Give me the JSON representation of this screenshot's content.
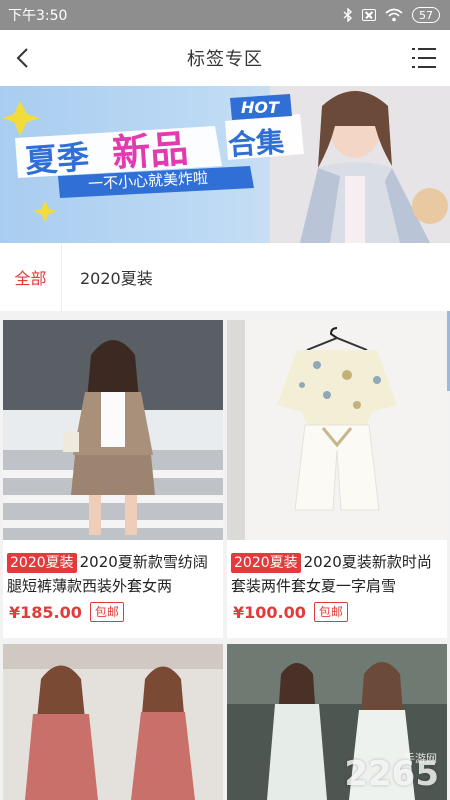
{
  "status_bar": {
    "time": "下午3:50",
    "battery": "57",
    "icons": [
      "bluetooth-icon",
      "no-sim-icon",
      "wifi-icon",
      "battery-icon"
    ]
  },
  "header": {
    "title": "标签专区",
    "back_icon": "chevron-left-icon",
    "menu_icon": "list-menu-icon"
  },
  "banner": {
    "hot": "HOT",
    "headline_1": "夏季",
    "headline_2": "新品",
    "headline_3": "合集",
    "slogan": "一不小心就美炸啦"
  },
  "filter": {
    "all_label": "全部",
    "tag_label": "2020夏装"
  },
  "products": [
    {
      "tag": "2020夏装",
      "title": "2020夏新款雪纺阔腿短裤薄款西装外套女两",
      "price": "¥185.00",
      "shipping": "包邮"
    },
    {
      "tag": "2020夏装",
      "title": "2020夏装新款时尚套装两件套女夏一字肩雪",
      "price": "¥100.00",
      "shipping": "包邮"
    }
  ],
  "watermark": {
    "text": "2265",
    "sub": "手游网"
  },
  "colors": {
    "accent": "#e23b3b",
    "status_bar": "#8e8e8e",
    "background": "#f2f2f2"
  }
}
